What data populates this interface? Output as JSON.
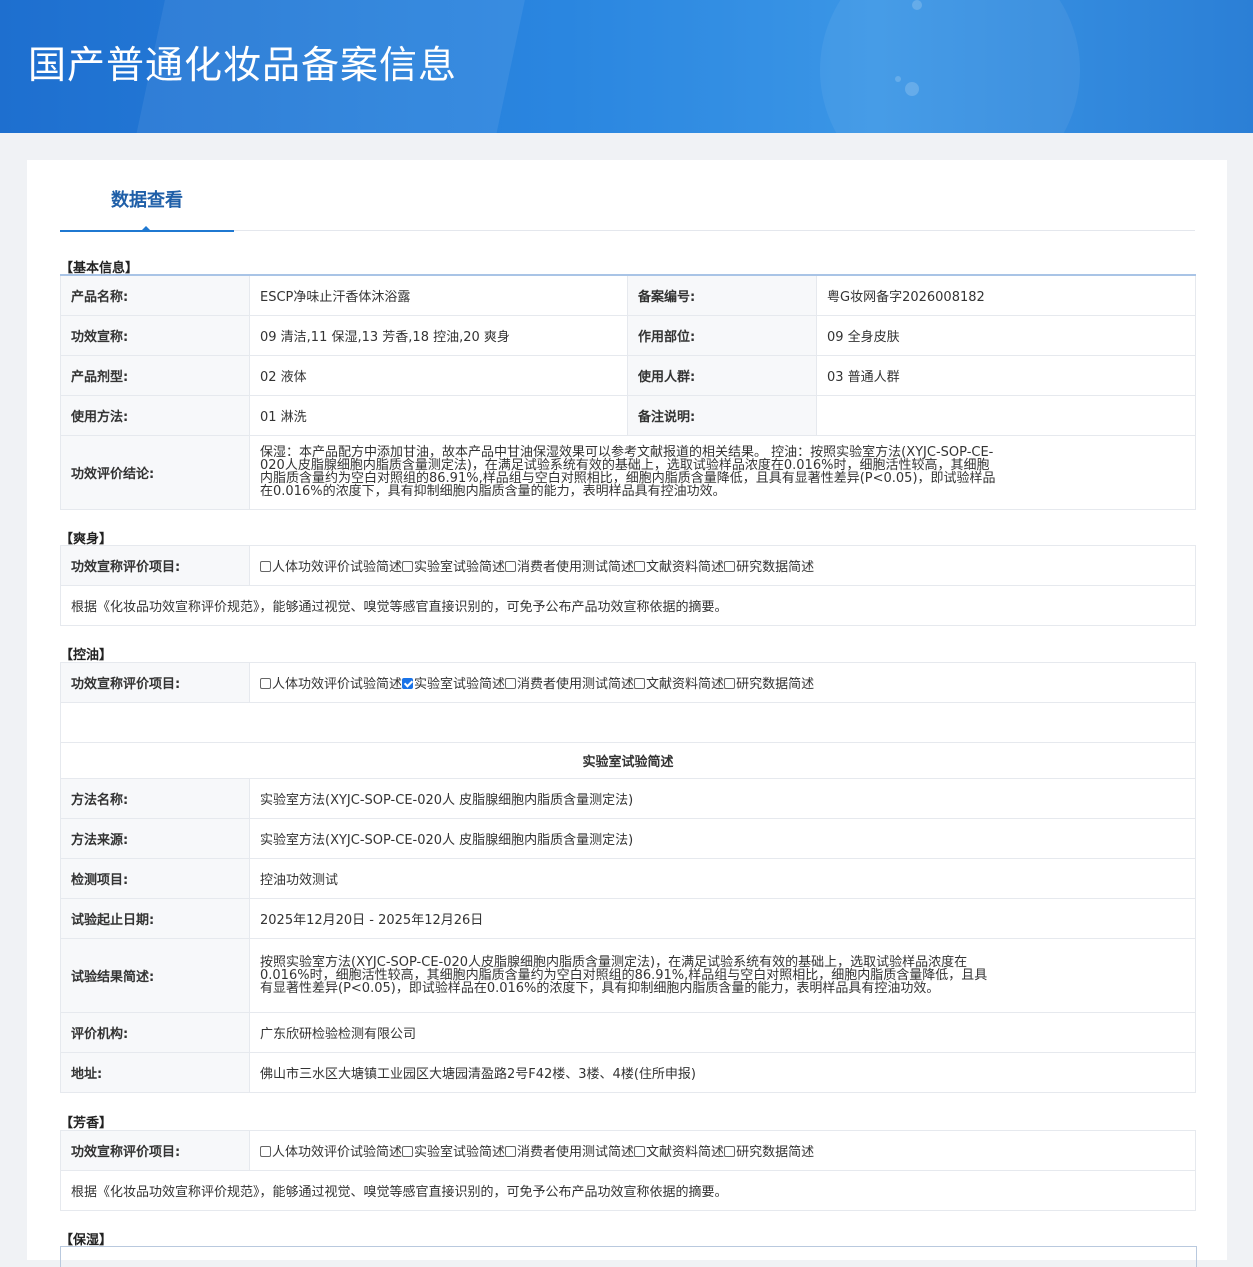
{
  "header": {
    "title": "国产普通化妆品备案信息"
  },
  "tabs": [
    {
      "label": "数据查看"
    }
  ],
  "basic": {
    "section_title": "【基本信息】",
    "product_name_label": "产品名称:",
    "product_name": "ESCP净味止汗香体沐浴露",
    "record_no_label": "备案编号:",
    "record_no": "粤G妆网备字2026008182",
    "claims_label": "功效宣称:",
    "claims": "09 清洁,11 保湿,13 芳香,18 控油,20 爽身",
    "part_label": "作用部位:",
    "part": "09 全身皮肤",
    "form_label": "产品剂型:",
    "form": "02 液体",
    "users_label": "使用人群:",
    "users": "03 普通人群",
    "usage_label": "使用方法:",
    "usage": "01 淋洗",
    "remark_label": "备注说明:",
    "remark": "",
    "conclusion_label": "功效评价结论:",
    "conclusion": "保湿：本产品配方中添加甘油，故本产品中甘油保湿效果可以参考文献报道的相关结果。 控油：按照实验室方法(XYJC-SOP-CE-020人皮脂腺细胞内脂质含量测定法)，在满足试验系统有效的基础上，选取试验样品浓度在0.016%时，细胞活性较高，其细胞内脂质含量约为空白对照组的86.91%,样品组与空白对照相比，细胞内脂质含量降低，且具有显著性差异(P<0.05)，即试验样品在0.016%的浓度下，具有抑制细胞内脂质含量的能力，表明样品具有控油功效。"
  },
  "eval_items": {
    "label": "功效宣称评价项目:",
    "options": [
      "人体功效评价试验简述",
      "实验室试验简述",
      "消费者使用测试简述",
      "文献资料简述",
      "研究数据简述"
    ]
  },
  "shuangshen": {
    "section_title": "【爽身】",
    "note": "根据《化妆品功效宣称评价规范》，能够通过视觉、嗅觉等感官直接识别的，可免予公布产品功效宣称依据的摘要。"
  },
  "kongyou": {
    "section_title": "【控油】",
    "lab_title": "实验室试验简述",
    "method_name_label": "方法名称:",
    "method_name": "实验室方法(XYJC-SOP-CE-020人 皮脂腺细胞内脂质含量测定法)",
    "method_source_label": "方法来源:",
    "method_source": "实验室方法(XYJC-SOP-CE-020人 皮脂腺细胞内脂质含量测定法)",
    "test_item_label": "检测项目:",
    "test_item": "控油功效测试",
    "date_label": "试验起止日期:",
    "date": "2025年12月20日 - 2025年12月26日",
    "result_label": "试验结果简述:",
    "result": "按照实验室方法(XYJC-SOP-CE-020人皮脂腺细胞内脂质含量测定法)，在满足试验系统有效的基础上，选取试验样品浓度在0.016%时，细胞活性较高，其细胞内脂质含量约为空白对照组的86.91%,样品组与空白对照相比，细胞内脂质含量降低，且具有显著性差异(P<0.05)，即试验样品在0.016%的浓度下，具有抑制细胞内脂质含量的能力，表明样品具有控油功效。",
    "org_label": "评价机构:",
    "org": "广东欣研检验检测有限公司",
    "addr_label": "地址:",
    "addr": "佛山市三水区大塘镇工业园区大塘园清盈路2号F42楼、3楼、4楼(住所申报)"
  },
  "fangxiang": {
    "section_title": "【芳香】",
    "note": "根据《化妆品功效宣称评价规范》，能够通过视觉、嗅觉等感官直接识别的，可免予公布产品功效宣称依据的摘要。"
  },
  "baoshi": {
    "section_title": "【保湿】"
  }
}
